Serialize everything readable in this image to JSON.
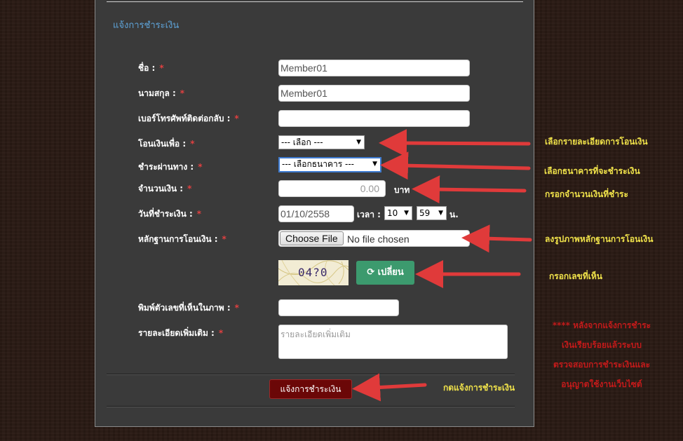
{
  "form": {
    "title": "แจ้งการชำระเงิน",
    "required_mark": "*",
    "first_name": {
      "label": "ชื่อ :",
      "value": "Member01"
    },
    "last_name": {
      "label": "นามสกุล :",
      "value": "Member01"
    },
    "phone": {
      "label": "เบอร์โทรศัพท์ติดต่อกลับ :",
      "value": ""
    },
    "transfer_for": {
      "label": "โอนเงินเพื่อ :",
      "selected": "--- เลือก ---"
    },
    "pay_via": {
      "label": "ชำระผ่านทาง :",
      "selected": "--- เลือกธนาคาร ---"
    },
    "amount": {
      "label": "จำนวนเงิน :",
      "value": "0.00",
      "unit": "บาท"
    },
    "pay_date": {
      "label": "วันที่ชำระเงิน :",
      "value": "01/10/2558",
      "time_label": "เวลา :",
      "hour": "10",
      "minute": "59",
      "suffix": "น."
    },
    "evidence": {
      "label": "หลักฐานการโอนเงิน :",
      "button": "Choose File",
      "status": "No file chosen"
    },
    "captcha": {
      "text": "04?0",
      "refresh_label": "เปลี่ยน"
    },
    "captcha_input": {
      "label": "พิมพ์ตัวเลขที่เห็นในภาพ :",
      "value": ""
    },
    "details": {
      "label": "รายละเอียดเพิ่มเติม :",
      "placeholder": "รายละเอียดเพิ่มเติม"
    },
    "submit_label": "แจ้งการชำระเงิน"
  },
  "annotations": {
    "transfer_for": "เลือกรายละเอียดการโอนเงิน",
    "pay_via": "เลือกธนาคารที่จะชำระเงิน",
    "amount": "กรอกจำนวนเงินที่ชำระ",
    "evidence": "ลงรูปภาพหลักฐานการโอนเงิน",
    "captcha": "กรอกเลขที่เห็น",
    "submit": "กดแจ้งการชำระเงิน",
    "footnote": [
      "**** หลังจากแจ้งการชำระ",
      "เงินเรียบร้อยแล้วระบบ",
      "ตรวจสอบการชำระเงินและ",
      "อนุญาตใช้งานเว็บไซต์"
    ]
  },
  "colors": {
    "arrow": "#e03a3a",
    "note": "#f0e24a",
    "footnote": "#c31a1a",
    "submit": "#6b0707",
    "refresh": "#3c9a6e"
  }
}
